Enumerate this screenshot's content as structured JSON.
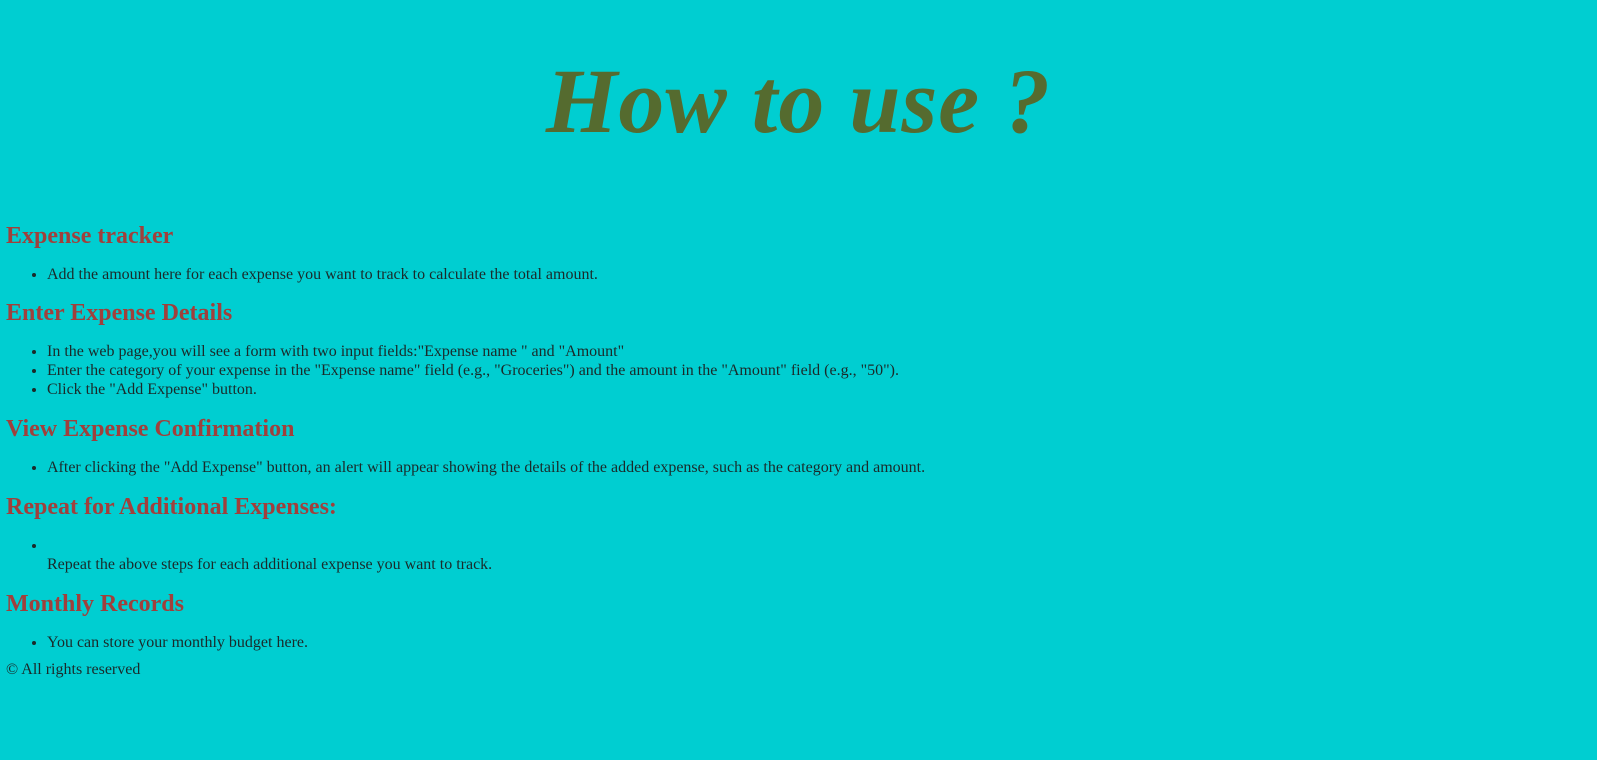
{
  "page": {
    "title": "How to use ?"
  },
  "sections": [
    {
      "heading": "Expense tracker",
      "items": [
        "Add the amount here for each expense you want to track to calculate the total amount."
      ]
    },
    {
      "heading": "Enter Expense Details",
      "items": [
        "In the web page,you will see a form with two input fields:\"Expense name \" and \"Amount\"",
        "Enter the category of your expense in the \"Expense name\" field (e.g., \"Groceries\") and the amount in the \"Amount\" field (e.g., \"50\").",
        "Click the \"Add Expense\" button."
      ]
    },
    {
      "heading": "View Expense Confirmation",
      "items": [
        "After clicking the \"Add Expense\" button, an alert will appear showing the details of the added expense, such as the category and amount."
      ]
    },
    {
      "heading": "Repeat for Additional Expenses:",
      "items": [
        "Repeat the above steps for each additional expense you want to track."
      ]
    },
    {
      "heading": "Monthly Records",
      "items": [
        "You can store your monthly budget here."
      ]
    }
  ],
  "footer": {
    "text": "© All rights reserved"
  },
  "colors": {
    "background": "#00CED1",
    "title": "#556B2F",
    "heading": "#A0403C",
    "text": "#1a2a2a"
  }
}
